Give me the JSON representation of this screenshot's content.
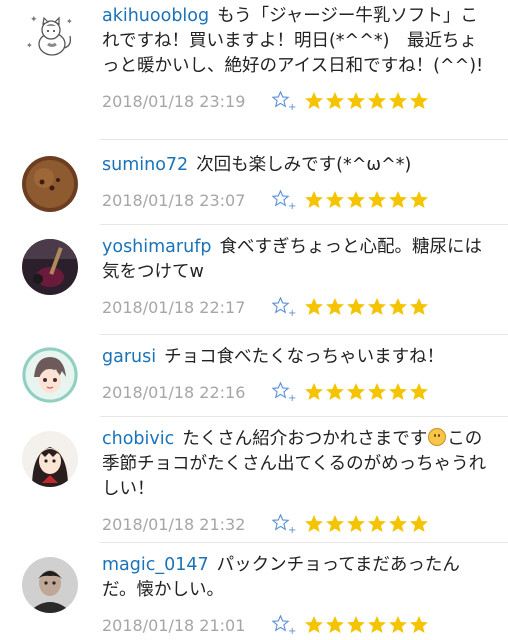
{
  "comments": [
    {
      "username": "akihuooblog",
      "text": "もう「ジャージー牛乳ソフト」これですね！買いますよ！明日(*^^*)　最近ちょっと暖かいし、絶好のアイス日和ですね！(^^)!",
      "timestamp": "2018/01/18 23:19",
      "rating": 6,
      "avatar_icon": "cat-illustration-icon"
    },
    {
      "username": "sumino72",
      "text": "次回も楽しみです(*^ω^*)",
      "timestamp": "2018/01/18 23:07",
      "rating": 6,
      "avatar_icon": "brown-ball-avatar"
    },
    {
      "username": "yoshimarufp",
      "text": "食べすぎちょっと心配。糖尿には気をつけてw",
      "timestamp": "2018/01/18 22:17",
      "rating": 6,
      "avatar_icon": "guitar-photo-avatar"
    },
    {
      "username": "garusi",
      "text": "チョコ食べたくなっちゃいますね！",
      "timestamp": "2018/01/18 22:16",
      "rating": 6,
      "avatar_icon": "anime-character-avatar"
    },
    {
      "username": "chobivic",
      "text_before_emoji": "たくさん紹介おつかれさまです",
      "text_after_emoji": "この季節チョコがたくさん出てくるのがめっちゃうれしい！",
      "emoji": "smiling-face-emoji",
      "timestamp": "2018/01/18 21:32",
      "rating": 6,
      "avatar_icon": "drawn-girl-avatar"
    },
    {
      "username": "magic_0147",
      "text": "パックンチョってまだあったんだ。懐かしい。",
      "timestamp": "2018/01/18 21:01",
      "rating": 6,
      "avatar_icon": "person-photo-avatar"
    }
  ],
  "colors": {
    "username": "#1a73b8",
    "star": "#f5c400",
    "star_outline": "#5b8fd6",
    "timestamp": "#a6a6a6"
  },
  "icons": {
    "add_star": "star-add-icon",
    "rating_star": "star-icon"
  }
}
